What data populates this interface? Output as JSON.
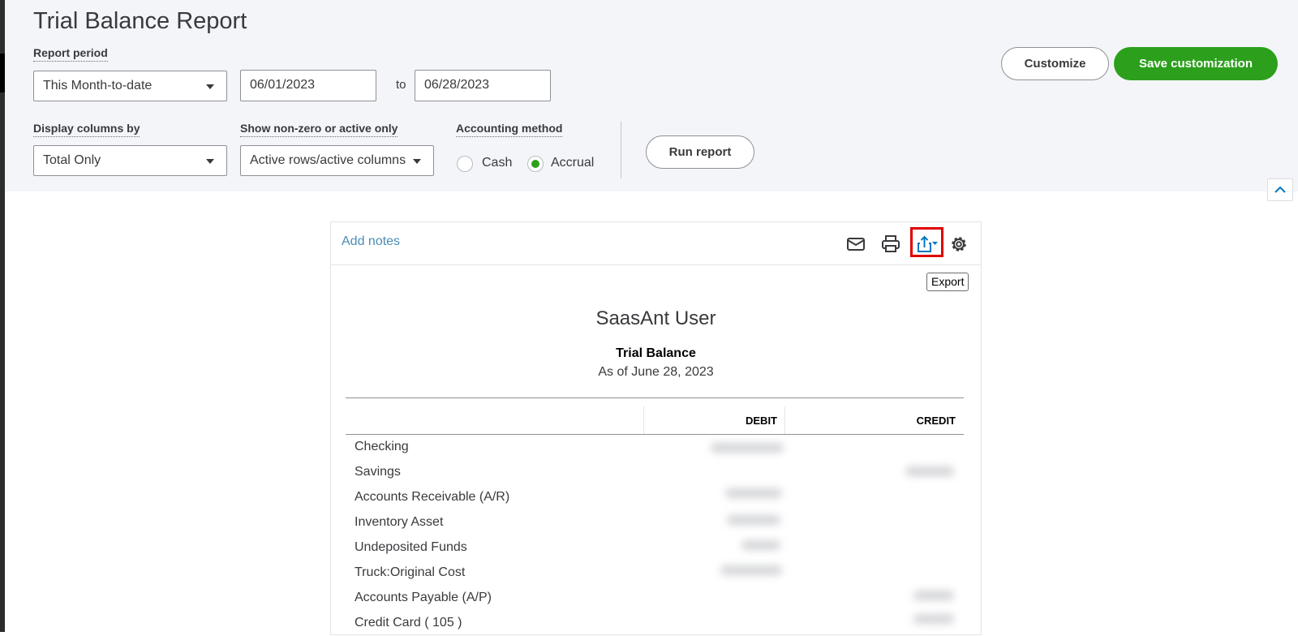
{
  "page": {
    "title": "Trial Balance Report"
  },
  "filters": {
    "report_period": {
      "label": "Report period",
      "value": "This Month-to-date"
    },
    "date_from": "06/01/2023",
    "to_label": "to",
    "date_to": "06/28/2023",
    "display_columns": {
      "label": "Display columns by",
      "value": "Total Only"
    },
    "non_zero": {
      "label": "Show non-zero or active only",
      "value": "Active rows/active columns"
    },
    "accounting_method": {
      "label": "Accounting method",
      "options": [
        {
          "label": "Cash",
          "checked": false
        },
        {
          "label": "Accrual",
          "checked": true
        }
      ]
    }
  },
  "buttons": {
    "customize": "Customize",
    "save_customization": "Save customization",
    "run_report": "Run report"
  },
  "toolbar": {
    "add_notes": "Add notes",
    "icons": [
      "email-icon",
      "print-icon",
      "export-icon",
      "settings-icon"
    ],
    "tooltip": "Export",
    "highlight_color": "#e00000"
  },
  "report": {
    "company": "SaasAnt User",
    "title": "Trial Balance",
    "subtitle": "As of June 28, 2023",
    "columns": [
      "DEBIT",
      "CREDIT"
    ],
    "rows": [
      {
        "name": "Checking",
        "debit": "blurred",
        "credit": ""
      },
      {
        "name": "Savings",
        "debit": "",
        "credit": "blurred"
      },
      {
        "name": "Accounts Receivable (A/R)",
        "debit": "blurred",
        "credit": ""
      },
      {
        "name": "Inventory Asset",
        "debit": "blurred",
        "credit": ""
      },
      {
        "name": "Undeposited Funds",
        "debit": "blurred",
        "credit": ""
      },
      {
        "name": "Truck:Original Cost",
        "debit": "blurred",
        "credit": ""
      },
      {
        "name": "Accounts Payable (A/P)",
        "debit": "",
        "credit": "blurred"
      },
      {
        "name": "Credit Card ( 105 )",
        "debit": "",
        "credit": "blurred"
      }
    ]
  },
  "colors": {
    "accent_green": "#2ca01c",
    "link_blue": "#4a8db4",
    "header_bg": "#f4f5f8"
  }
}
